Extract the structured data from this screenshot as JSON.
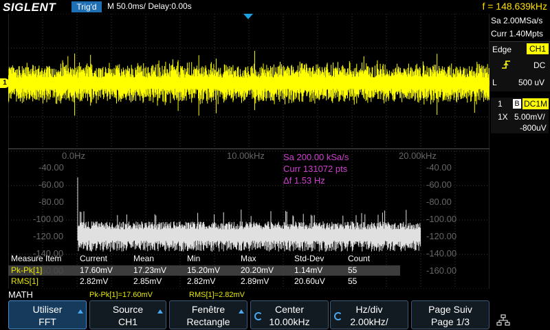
{
  "header": {
    "logo": "SIGLENT",
    "trigger_state": "Trig'd",
    "timebase": "M 50.0ms/ Delay:0.00s",
    "frequency": "f = 148.639kHz"
  },
  "acquisition": {
    "sample_rate": "Sa 2.00MSa/s",
    "memory": "Curr 1.40Mpts"
  },
  "trigger": {
    "type": "Edge",
    "source": "CH1",
    "slope_icon": "rising-edge-icon",
    "coupling": "DC",
    "level_label": "L",
    "level": "500 uV"
  },
  "channel1": {
    "number": "1",
    "bw_flag": "B",
    "coupling": "DC1M",
    "probe": "1X",
    "scale": "5.00mV/",
    "offset": "-800uV",
    "marker": "1"
  },
  "fft": {
    "x_labels": [
      "0.0Hz",
      "10.00kHz",
      "20.00kHz"
    ],
    "y_labels_left": [
      "-40.00",
      "-60.00",
      "-80.00",
      "-100.00",
      "-120.00",
      "-140.00",
      "-160.00"
    ],
    "y_labels_right": [
      "-40.00",
      "-60.00",
      "-80.00",
      "-100.00",
      "-120.00",
      "-140.00",
      "-160.00"
    ],
    "info_rate": "Sa 200.00 kSa/s",
    "info_points": "Curr 131072 pts",
    "info_resolution": "Δf 1.53 Hz"
  },
  "measure": {
    "headers": [
      "Measure Item",
      "Current",
      "Mean",
      "Min",
      "Max",
      "Std-Dev",
      "Count"
    ],
    "rows": [
      {
        "item": "Pk-Pk[1]",
        "current": "17.60mV",
        "mean": "17.23mV",
        "min": "15.20mV",
        "max": "20.20mV",
        "std": "1.14mV",
        "count": "55"
      },
      {
        "item": "RMS[1]",
        "current": "2.82mV",
        "mean": "2.85mV",
        "min": "2.82mV",
        "max": "2.89mV",
        "std": "20.60uV",
        "count": "55"
      }
    ],
    "summary_pkpk": "Pk-Pk[1]=17.60mV",
    "summary_rms": "RMS[1]=2.82mV"
  },
  "menu": {
    "title": "MATH",
    "keys": [
      {
        "line1": "Utiliser",
        "line2": "FFT"
      },
      {
        "line1": "Source",
        "line2": "CH1"
      },
      {
        "line1": "Fenêtre",
        "line2": "Rectangle"
      },
      {
        "line1": "Center",
        "line2": "10.00kHz"
      },
      {
        "line1": "Hz/div",
        "line2": "2.00kHz/"
      },
      {
        "line1": "Page Suiv",
        "line2": "Page 1/3"
      }
    ]
  },
  "colors": {
    "ch1": "#ffff00",
    "math": "#e0e0e0",
    "fft_info": "#d040d0",
    "accent": "#1f6fb5",
    "measure_label": "#e8e800"
  }
}
